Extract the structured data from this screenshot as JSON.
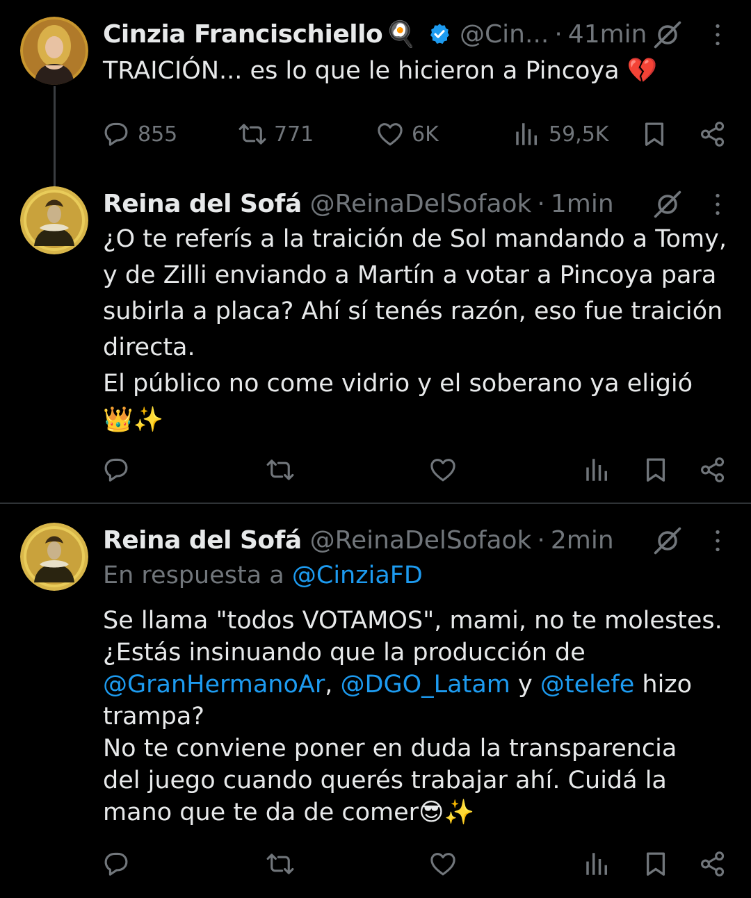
{
  "tweets": [
    {
      "name": "Cinzia Francischiello",
      "name_emoji": "🍳",
      "handle": "@Cin...",
      "time": "41min",
      "text_lines": [
        "TRAICIÓN... es lo que le hicieron a Pincoya 💔"
      ],
      "stats": {
        "replies": "855",
        "retweets": "771",
        "likes": "6K",
        "views": "59,5K"
      }
    },
    {
      "name": "Reina del Sofá",
      "handle": "@ReinaDelSofaok",
      "time": "1min",
      "text_lines": [
        "¿O te referís a la traición de Sol mandando a Tomy,",
        "y de Zilli enviando a Martín a votar a Pincoya para",
        "subirla a placa? Ahí sí tenés razón, eso fue traición",
        "directa.",
        "El público no come vidrio y el soberano ya eligió",
        "👑✨"
      ]
    },
    {
      "name": "Reina del Sofá",
      "handle": "@ReinaDelSofaok",
      "time": "2min",
      "reply_prefix": "En respuesta a",
      "reply_mention": "@CinziaFD",
      "line1": "Se llama \"todos VOTAMOS\", mami, no te molestes.",
      "line2": "¿Estás insinuando que la producción de",
      "mention1": "@GranHermanoAr",
      "sep1": ",",
      "mention2": "@DGO_Latam",
      "sep2": "y",
      "mention3": "@telefe",
      "sep3": "hizo",
      "line4": "trampa?",
      "line5": "No te conviene poner en duda la transparencia",
      "line6": "del juego cuando querés trabajar ahí. Cuidá la",
      "line7": "mano que te da de comer😎✨"
    }
  ],
  "separator": "·",
  "icons": {
    "reply": "reply-icon",
    "retweet": "retweet-icon",
    "like": "heart-icon",
    "views": "views-icon",
    "bookmark": "bookmark-icon",
    "share": "share-icon",
    "grok": "grok-icon",
    "more": "more-icon",
    "verified": "verified-badge-icon"
  },
  "colors": {
    "background": "#000000",
    "text": "#e7e9ea",
    "muted": "#71767b",
    "link": "#1d9bf0",
    "verified": "#1d9bf0",
    "divider": "#2f3336"
  }
}
